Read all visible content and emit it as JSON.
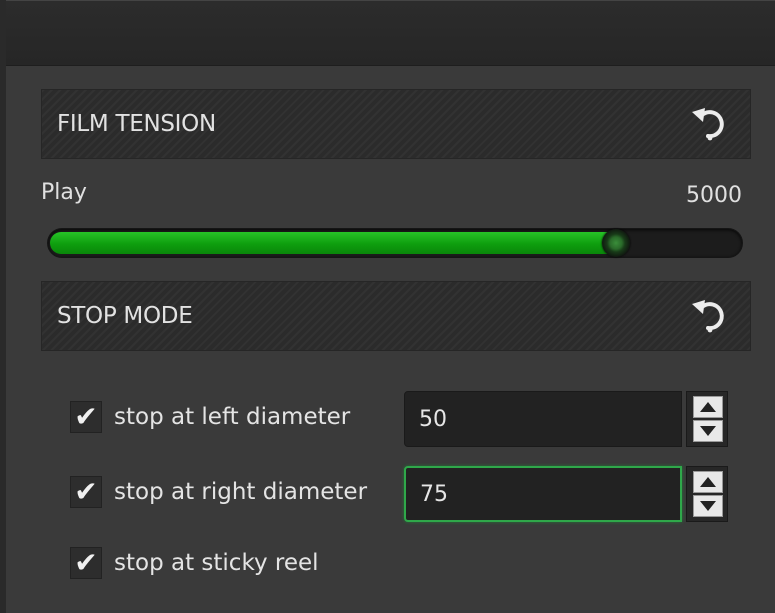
{
  "film_tension": {
    "title": "FILM TENSION",
    "reset_icon": "reset-icon",
    "play_label": "Play",
    "play_value": "5000",
    "play_fill_fraction": 0.82
  },
  "stop_mode": {
    "title": "STOP MODE",
    "reset_icon": "reset-icon",
    "options": [
      {
        "label": "stop at left diameter",
        "checked": true,
        "value": "50"
      },
      {
        "label": "stop at right diameter",
        "checked": true,
        "value": "75"
      },
      {
        "label": "stop at sticky reel",
        "checked": true
      }
    ]
  },
  "colors": {
    "accent_green": "#0e9e0e",
    "focus_border": "#2fa84a",
    "panel_bg": "#3a3a3a"
  }
}
